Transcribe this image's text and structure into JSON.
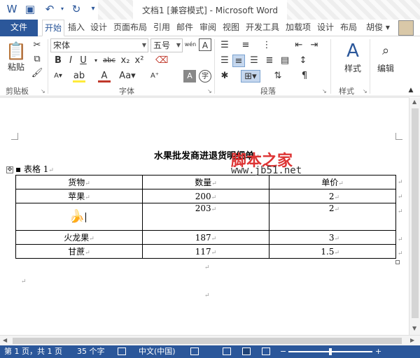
{
  "window": {
    "title": "文档1 [兼容模式] - Microsoft Word"
  },
  "tabs": {
    "file": "文件",
    "items": [
      "开始",
      "插入",
      "设计",
      "页面布局",
      "引用",
      "邮件",
      "审阅",
      "视图",
      "开发工具",
      "加载项",
      "设计",
      "布局"
    ],
    "active_index": 0,
    "user": "胡俊"
  },
  "ribbon": {
    "clipboard": {
      "group": "剪贴板",
      "paste": "粘贴"
    },
    "font": {
      "group": "字体",
      "name": "宋体",
      "size": "五号",
      "wen": "wén"
    },
    "paragraph": {
      "group": "段落"
    },
    "styles": {
      "group": "样式",
      "label": "样式"
    },
    "editing": {
      "label": "编辑"
    }
  },
  "document": {
    "heading": "水果批发商进退货明细单",
    "caption": "表格  1",
    "paragraph_mark": "↵",
    "table": {
      "rows": [
        [
          "货物",
          "数量",
          "单价"
        ],
        [
          "苹果",
          "200",
          "2"
        ],
        [
          "",
          "203",
          "2"
        ],
        [
          "火龙果",
          "187",
          "3"
        ],
        [
          "甘蔗",
          "117",
          "1.5"
        ]
      ],
      "image_cell_icon": "banana-icon"
    }
  },
  "watermark": {
    "line1": "脚本之家",
    "line2": "www.jb51.net"
  },
  "status": {
    "page": "第 1 页，共 1 页",
    "words": "35 个字",
    "language": "中文(中国)"
  },
  "colors": {
    "accent": "#2b579a",
    "status_bar": "#2b579a"
  }
}
